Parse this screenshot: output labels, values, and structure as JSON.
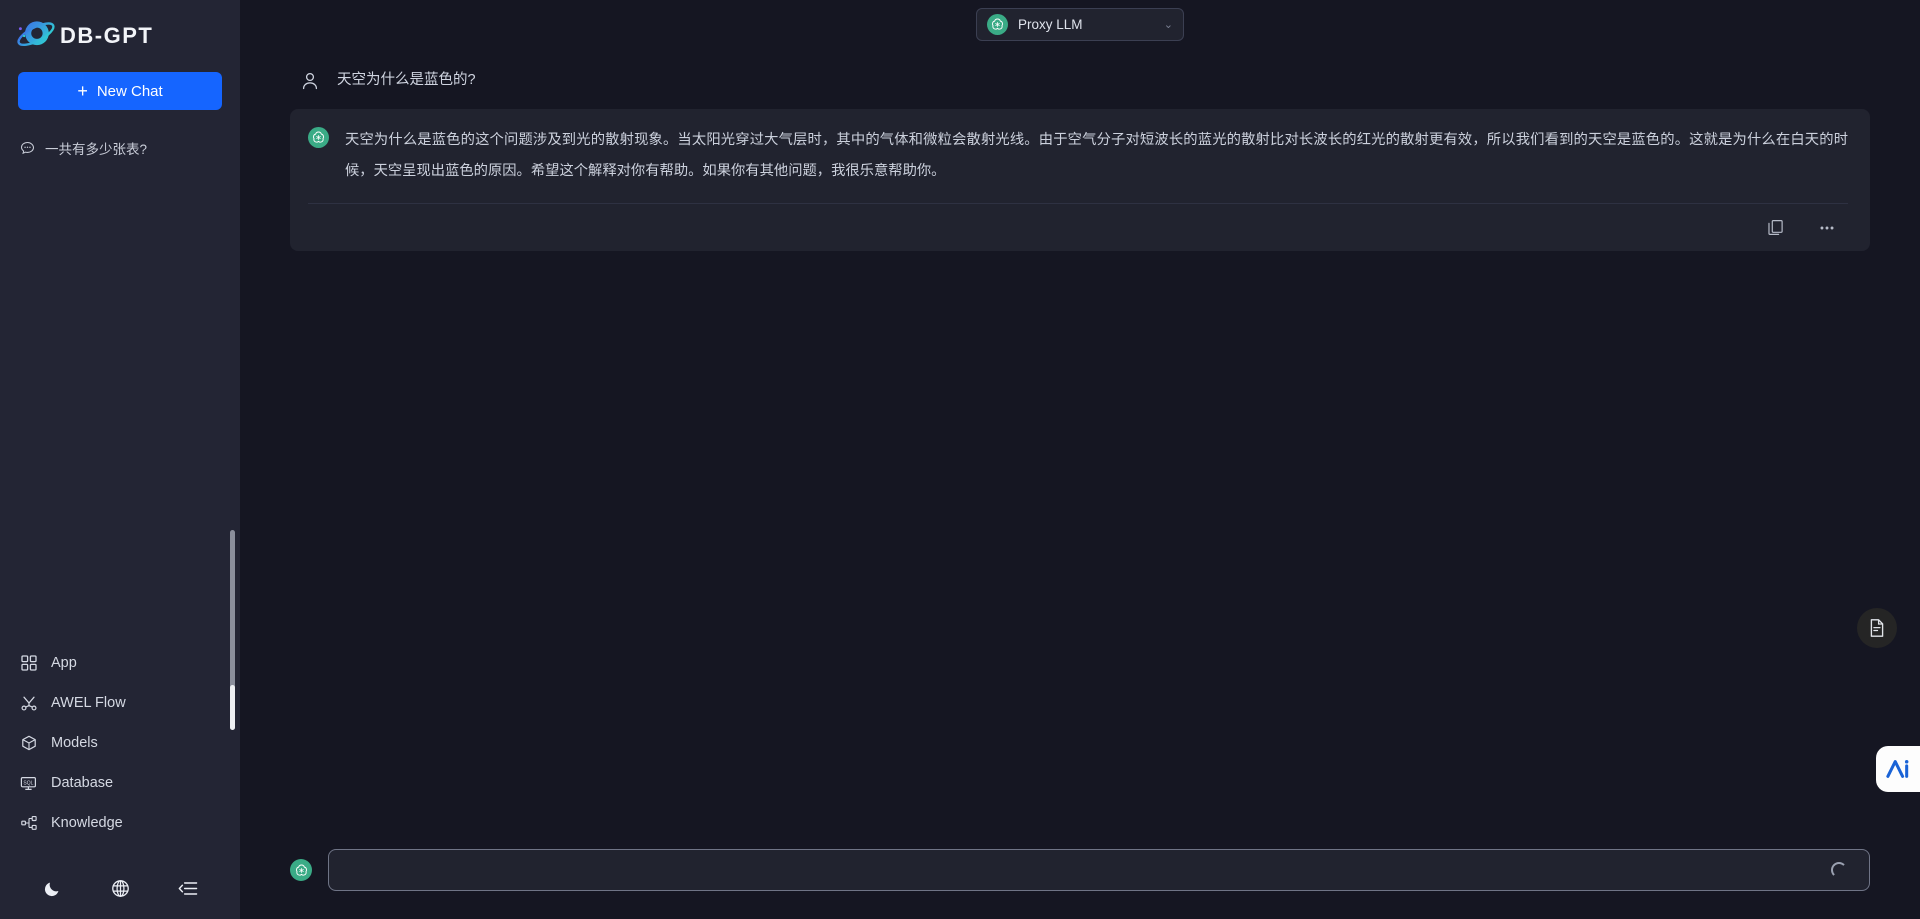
{
  "brand": {
    "name": "DB-GPT",
    "logo_icon": "planet-logo-icon"
  },
  "sidebar": {
    "new_chat_label": "New Chat",
    "new_chat_icon": "plus-icon",
    "history": [
      {
        "label": "一共有多少张表?",
        "icon": "chat-bubble-icon"
      }
    ],
    "nav": [
      {
        "label": "App",
        "icon": "grid-apps-icon"
      },
      {
        "label": "AWEL Flow",
        "icon": "flow-branch-icon"
      },
      {
        "label": "Models",
        "icon": "cube-icon"
      },
      {
        "label": "Database",
        "icon": "sql-database-icon"
      },
      {
        "label": "Knowledge",
        "icon": "knowledge-graph-icon"
      }
    ],
    "footer_buttons": [
      {
        "name": "theme-toggle",
        "icon": "moon-icon"
      },
      {
        "name": "language-switch",
        "icon": "globe-icon"
      },
      {
        "name": "collapse-sidebar",
        "icon": "collapse-panel-icon"
      }
    ]
  },
  "topbar": {
    "model": {
      "label": "Proxy LLM",
      "icon": "openai-logo-icon",
      "chevron": "⌄"
    }
  },
  "conversation": {
    "user_message": {
      "text": "天空为什么是蓝色的?",
      "avatar_icon": "person-icon"
    },
    "bot_message": {
      "text": "天空为什么是蓝色的这个问题涉及到光的散射现象。当太阳光穿过大气层时，其中的气体和微粒会散射光线。由于空气分子对短波长的蓝光的散射比对长波长的红光的散射更有效，所以我们看到的天空是蓝色的。这就是为什么在白天的时候，天空呈现出蓝色的原因。希望这个解释对你有帮助。如果你有其他问题，我很乐意帮助你。",
      "avatar_icon": "openai-logo-icon",
      "actions": [
        {
          "name": "copy-message-button",
          "icon": "copy-icon"
        },
        {
          "name": "more-options-button",
          "icon": "ellipsis-icon"
        }
      ]
    }
  },
  "floating": {
    "document_button": {
      "icon": "document-icon"
    },
    "ai_widget": {
      "icon": "ai-logo-icon"
    }
  },
  "composer": {
    "avatar_icon": "openai-logo-icon",
    "value": "",
    "placeholder": "",
    "status_icon": "loading-spinner-icon"
  },
  "colors": {
    "accent_blue": "#1565ff",
    "sidebar_bg": "#232534",
    "main_bg": "#151622",
    "card_bg": "#21232f",
    "avatar_green": "#3aab86",
    "ai_logo_blue": "#1a63d6"
  }
}
